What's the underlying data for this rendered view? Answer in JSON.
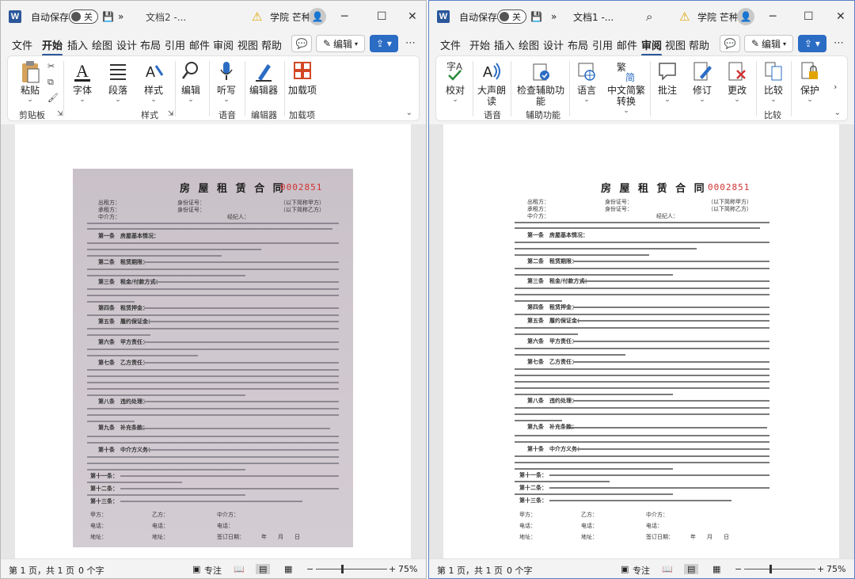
{
  "left": {
    "title": {
      "autosave": "自动保存",
      "toggle": "关",
      "docname": "文档2 -...",
      "user": "学院 芒种"
    },
    "tabs": [
      "文件",
      "开始",
      "插入",
      "绘图",
      "设计",
      "布局",
      "引用",
      "邮件",
      "审阅",
      "视图",
      "帮助"
    ],
    "active_tab": "开始",
    "edit_btn": "编辑",
    "ribbon": {
      "paste": "粘贴",
      "font": "字体",
      "paragraph": "段落",
      "styles": "样式",
      "edit": "编辑",
      "dictate": "听写",
      "editor": "编辑器",
      "addins": "加载项",
      "groups": {
        "clipboard": "剪贴板",
        "styles": "样式",
        "voice": "语音",
        "editor": "编辑器",
        "addins": "加载项"
      }
    },
    "status": {
      "page": "第 1 页，共 1 页",
      "words": "0 个字",
      "focus": "专注",
      "zoom": "75%"
    }
  },
  "right": {
    "title": {
      "autosave": "自动保存",
      "toggle": "关",
      "docname": "文档1 -...",
      "user": "学院 芒种"
    },
    "tabs": [
      "文件",
      "开始",
      "插入",
      "绘图",
      "设计",
      "布局",
      "引用",
      "邮件",
      "审阅",
      "视图",
      "帮助"
    ],
    "active_tab": "审阅",
    "edit_btn": "编辑",
    "ribbon": {
      "proof": "校对",
      "read_aloud": "大声朗读",
      "accessibility": "检查辅助功能",
      "language": "语言",
      "chinese": "中文简繁转换",
      "comments": "批注",
      "track": "修订",
      "changes": "更改",
      "compare": "比较",
      "protect": "保护",
      "groups": {
        "voice": "语音",
        "accessibility": "辅助功能",
        "compare": "比较"
      }
    },
    "status": {
      "page": "第 1 页，共 1 页",
      "words": "0 个字",
      "focus": "专注",
      "zoom": "75%"
    }
  },
  "document": {
    "title": "房 屋 租 赁 合 同",
    "serial": "0002851",
    "lessor": "出租方：",
    "lessee": "承租方：",
    "id": "身份证号：",
    "side_a": "（以下简称甲方）",
    "side_b": "（以下简称乙方）",
    "middle": "中介方：",
    "agent": "经纪人：",
    "sections": [
      "第一条　房屋基本情况：",
      "第二条　租赁期限：",
      "第三条　租金/付款方式：",
      "第四条　租赁押金：",
      "第五条　履约保证金：",
      "第六条　甲方责任：",
      "第七条　乙方责任：",
      "第八条　违约处理：",
      "第九条　补充条款：",
      "第十条　中介方义务：",
      "第十一条：",
      "第十二条：",
      "第十三条："
    ],
    "sign_a": "甲方：",
    "sign_b": "乙方：",
    "sign_c": "中介方：",
    "phone": "电话：",
    "address": "地址：",
    "sign_date": "签订日期：",
    "ym": "年　　月　　日"
  }
}
